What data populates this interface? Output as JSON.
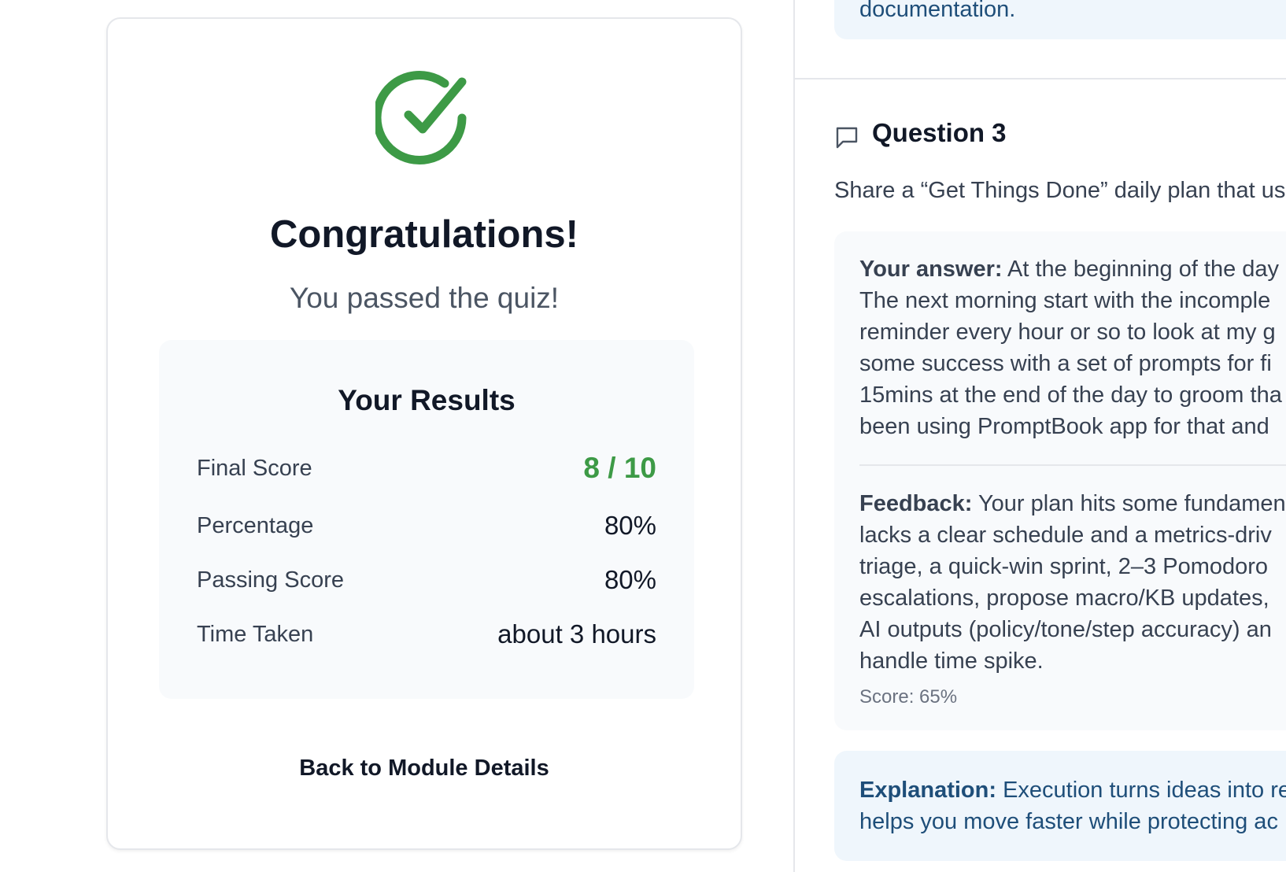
{
  "result_card": {
    "title": "Congratulations!",
    "subtitle": "You passed the quiz!",
    "results": {
      "heading": "Your Results",
      "rows": [
        {
          "label": "Final Score",
          "value": "8 / 10"
        },
        {
          "label": "Percentage",
          "value": "80%"
        },
        {
          "label": "Passing Score",
          "value": "80%"
        },
        {
          "label": "Time Taken",
          "value": "about 3 hours"
        }
      ]
    },
    "back_button_label": "Back to Module Details"
  },
  "review_panel": {
    "previous_explanation_tail": "documentation.",
    "question": {
      "title": "Question 3",
      "text": "Share a “Get Things Done” daily plan that us",
      "answer_label": "Your answer:",
      "answer_lines": [
        " At the beginning of the day",
        "The next morning start with the incomple",
        "reminder every hour or so to look at my g",
        "some success with a set of prompts for fi",
        "15mins at the end of the day to groom tha",
        "been using PromptBook app for that and"
      ],
      "feedback_label": "Feedback:",
      "feedback_lines": [
        " Your plan hits some fundamen",
        "lacks a clear schedule and a metrics-driv",
        "triage, a quick-win sprint, 2–3 Pomodoro",
        "escalations, propose macro/KB updates,",
        "AI outputs (policy/tone/step accuracy) an",
        "handle time spike."
      ],
      "score": "Score: 65%"
    },
    "explanation": {
      "label": "Explanation:",
      "lines": [
        " Execution turns ideas into re",
        "helps you move faster while protecting ac"
      ]
    }
  },
  "colors": {
    "success_green": "#3d9a46",
    "explanation_bg": "#eff6fc",
    "explanation_text": "#1e4e79",
    "panel_bg": "#f8fafc"
  },
  "icons": {
    "success": "check-circle-icon",
    "question": "chat-bubble-icon"
  }
}
